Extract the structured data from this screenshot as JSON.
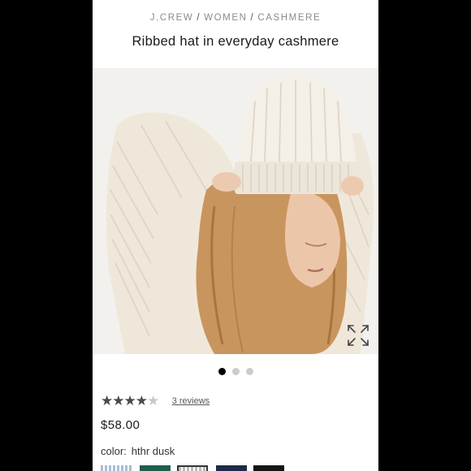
{
  "breadcrumb": {
    "brand": "J.CREW",
    "sep1": "/",
    "category": "WOMEN",
    "sep2": "/",
    "subcategory": "CASHMERE"
  },
  "product": {
    "title": "Ribbed hat in everyday cashmere",
    "price": "$58.00",
    "rating": 4,
    "rating_max": 5,
    "reviews_label": "3 reviews",
    "color_label": "color:",
    "color_value": "hthr dusk"
  },
  "gallery": {
    "image_count": 3,
    "active_index": 0,
    "expand_icon": "expand-arrows-icon"
  },
  "swatches": [
    {
      "name": "light-blue",
      "color": "#a9bdd6",
      "pattern": "stripe"
    },
    {
      "name": "green",
      "color": "#1f5e4f",
      "pattern": "solid"
    },
    {
      "name": "heather-grey",
      "color": "#b9b9b9",
      "pattern": "stripe",
      "selected": true
    },
    {
      "name": "navy",
      "color": "#1f2a4a",
      "pattern": "solid"
    },
    {
      "name": "black",
      "color": "#151515",
      "pattern": "solid"
    }
  ],
  "colors": {
    "frame": "#000000",
    "page": "#ffffff",
    "breadcrumb": "#8a8a8a",
    "active_dot": "#000000",
    "inactive_dot": "#cccccc"
  }
}
